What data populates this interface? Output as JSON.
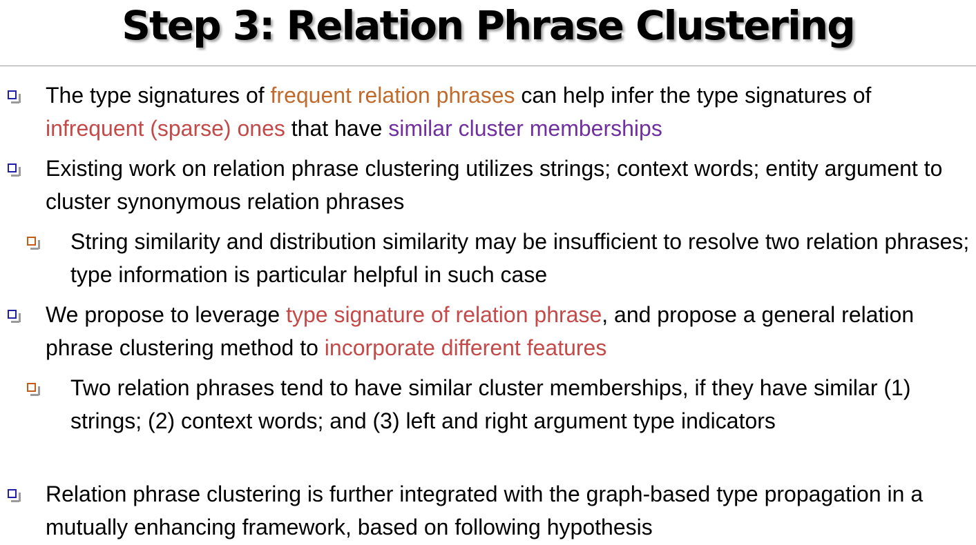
{
  "slide": {
    "title": "Step 3: Relation Phrase Clustering",
    "colors": {
      "level1_marker": "#1f1fa8",
      "level2_marker": "#c65a17",
      "highlight_orange": "#c06a2c",
      "highlight_red": "#c44a4a",
      "highlight_purple": "#7030a0"
    },
    "bullets": [
      {
        "level": 1,
        "segments": [
          {
            "text": "The type signatures of ",
            "style": "plain"
          },
          {
            "text": "frequent relation phrases",
            "style": "orange"
          },
          {
            "text": " can help infer the type signatures of ",
            "style": "plain"
          },
          {
            "text": "infrequent (sparse) ones",
            "style": "red"
          },
          {
            "text": " that have ",
            "style": "plain"
          },
          {
            "text": "similar cluster memberships",
            "style": "purple"
          }
        ]
      },
      {
        "level": 1,
        "segments": [
          {
            "text": "Existing work on relation phrase clustering utilizes strings; context words; entity argument to cluster synonymous relation phrases",
            "style": "plain"
          }
        ]
      },
      {
        "level": 2,
        "segments": [
          {
            "text": "String similarity and distribution similarity may be insufficient to resolve two relation phrases; type information is particular helpful in such case",
            "style": "plain"
          }
        ]
      },
      {
        "level": 1,
        "segments": [
          {
            "text": "We propose to leverage ",
            "style": "plain"
          },
          {
            "text": "type signature of relation phrase",
            "style": "red"
          },
          {
            "text": ", and propose a general relation phrase clustering method to ",
            "style": "plain"
          },
          {
            "text": "incorporate different features",
            "style": "red"
          }
        ]
      },
      {
        "level": 2,
        "segments": [
          {
            "text": "Two relation phrases tend to have similar cluster memberships, if they have similar (1) strings; (2) context words; and (3) left and right argument type indicators",
            "style": "plain"
          }
        ]
      },
      {
        "level": 1,
        "segments": [
          {
            "text": "Relation phrase clustering is further integrated with the graph-based type propagation in a mutually enhancing framework, based on following hypothesis",
            "style": "plain"
          }
        ]
      }
    ]
  }
}
